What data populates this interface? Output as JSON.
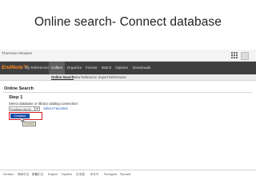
{
  "slide": {
    "title": "Online search- Connect database"
  },
  "header": {
    "brand": "Thomson Reuters"
  },
  "nav": {
    "logo": "EndNote™",
    "items": [
      {
        "label": "My References",
        "active": false
      },
      {
        "label": "Collect",
        "active": true
      },
      {
        "label": "Organize",
        "active": false
      },
      {
        "label": "Format",
        "active": false
      },
      {
        "label": "Match",
        "active": false
      },
      {
        "label": "Options",
        "active": false
      },
      {
        "label": "Downloads",
        "active": false
      }
    ]
  },
  "subnav": {
    "items": [
      {
        "label": "Online Search",
        "active": true
      },
      {
        "label": "New Reference",
        "active": false
      },
      {
        "label": "Import References",
        "active": false
      }
    ]
  },
  "panel": {
    "heading": "Online Search",
    "step": "Step 1",
    "instruction": "Select database or library catalog connection:",
    "select_value": "PubMed (NLM)",
    "favorites_link": "Select Favorites",
    "connect_label": "Connect",
    "tooltip": "Connect"
  },
  "footer": {
    "languages": [
      "Deutsch",
      "简体中文",
      "繁體中文",
      "English",
      "Español",
      "日本語",
      "한국어",
      "Português",
      "Русский"
    ]
  },
  "colors": {
    "nav_bg": "#3f3f3f",
    "logo": "#ff8a1c",
    "connect_button": "#1b4fa8",
    "highlight": "#d51f24",
    "link": "#1f5fbf"
  }
}
